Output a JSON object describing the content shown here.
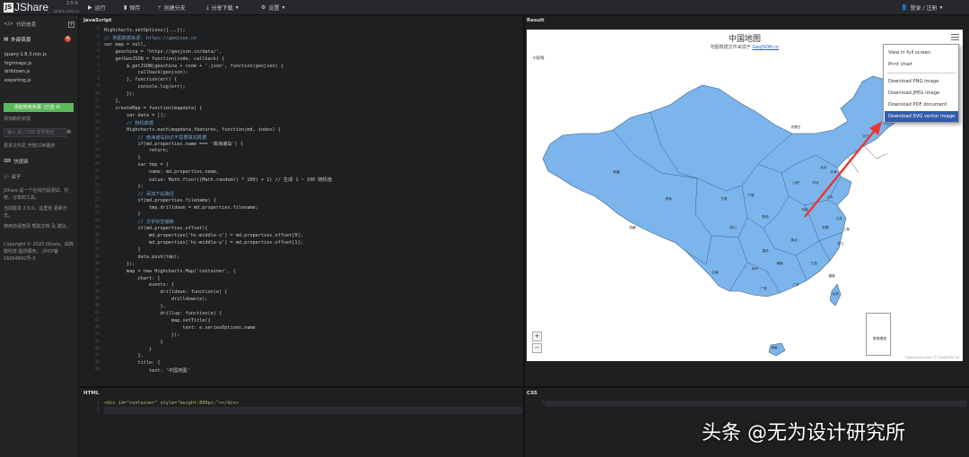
{
  "brand": {
    "logo_mark": "JS",
    "name": "JShare",
    "version": "2.5.0",
    "domain": "jshare.com.cn"
  },
  "toolbar": {
    "run": "运行",
    "save": "保存",
    "fork": "创建分支",
    "share": "分享下载",
    "settings": "设置",
    "login": "登录 / 注册"
  },
  "sidebar": {
    "code_info": "代码信息",
    "external_resources": "外部资源",
    "badge_count": "4",
    "files": [
      "jquery-1.8.3.min.js",
      "highmaps.js",
      "drilldown.js",
      "exporting.js"
    ],
    "add_button": "添加常用资源（已选 4）",
    "add_resource_label": "添加新的资源",
    "resource_input_placeholder": "输入 JS / CSS 文件地址",
    "more_text": "更多文件见 开放CDN服务",
    "shortcuts": "快捷键",
    "about": "关于",
    "about_text_1": "JShare 是一个在线代码测试、托管、分享的工具。",
    "about_text_2": "当前版本 2.5.0，这里有 更新日志。",
    "about_text_3": "使用前请查阅 帮助文档 及 建议。",
    "copyright": "Copyright © 2020 JShare。由简数科技 提供服务。 沪ICP备16004892号-3"
  },
  "panels": {
    "javascript": "JavaScript",
    "result": "Result",
    "html": "HTML",
    "css": "CSS"
  },
  "js_code": [
    "Highcharts.setOptions({...});",
    "// 地图数据来源: https://geojson.cn",
    "var map = null,",
    "    geochina = 'https://geojson.cn/data/',",
    "    getGeoJSON = function(code, callback) {",
    "        $.getJSON(geochina + code + '.json', function(geojson) {",
    "            callback(geojson);",
    "        }, function(err) {",
    "            console.log(err);",
    "        });",
    "    },",
    "    createMap = function(mapdata) {",
    "        var data = [];",
    "        // 随机数据",
    "        Highcharts.each(mapdata.features, function(md, index) {",
    "            // 南海诸岛标识不需要填充数据",
    "            if(md.properties.name === '南海诸岛') {",
    "                return;",
    "            }",
    "            var tmp = {",
    "                name: md.properties.name,",
    "                value: Math.floor((Math.random() * 100) + 1) // 生成 1 ~ 100 随机值",
    "            };",
    "            // 添加下钻路径",
    "            if(md.properties.filename) {",
    "                tmp.drilldown = md.properties.filename;",
    "            }",
    "            // 文字标签偏移",
    "            if(md.properties.offset){",
    "                md.properties['hc-middle-x'] = md.properties.offset[0];",
    "                md.properties['hc-middle-y'] = md.properties.offset[1];",
    "            }",
    "            data.push(tmp);",
    "        });",
    "        map = new Highcharts.Map('container', {",
    "            chart: {",
    "                events: {",
    "                    drilldown: function(e) {",
    "                        drilldown(e);",
    "                    },",
    "                    drillup: function(e) {",
    "                        map.setTitle({",
    "                            text: e.seriesOptions.name",
    "                        });",
    "                    }",
    "                }",
    "            },",
    "            title: {",
    "                text: '中国地图'"
  ],
  "html_code": [
    "<div id=\"container\" style=\"height:800px;\"></div>",
    ""
  ],
  "css_code": [
    ""
  ],
  "map": {
    "title": "中国地图",
    "subtitle_prefix": "地图数据文件来源于 ",
    "subtitle_link": "GeoJSON.cn",
    "nine_dash_label": "十段线",
    "south_sea_label": "南海诸岛",
    "credits": "Highcharts.com © GeoJSON.CN",
    "zoom_in": "+",
    "zoom_out": "−",
    "fill_color": "#7cb5ec",
    "province_labels": [
      "新疆",
      "西藏",
      "青海",
      "甘肃",
      "内蒙古",
      "黑龙江",
      "吉林",
      "辽宁",
      "北京",
      "天津",
      "河北",
      "山西",
      "陕西",
      "宁夏",
      "河南",
      "山东",
      "江苏",
      "安徽",
      "湖北",
      "四川",
      "重庆",
      "贵州",
      "云南",
      "湖南",
      "江西",
      "浙江",
      "福建",
      "广东",
      "广西",
      "海南",
      "上海",
      "台湾"
    ]
  },
  "export_menu": {
    "items": [
      "View in full screen",
      "Print chart",
      "Download PNG image",
      "Download JPEG image",
      "Download PDF document",
      "Download SVG vector image"
    ],
    "active_index": 5
  },
  "watermark": "头条 @无为设计研究所"
}
